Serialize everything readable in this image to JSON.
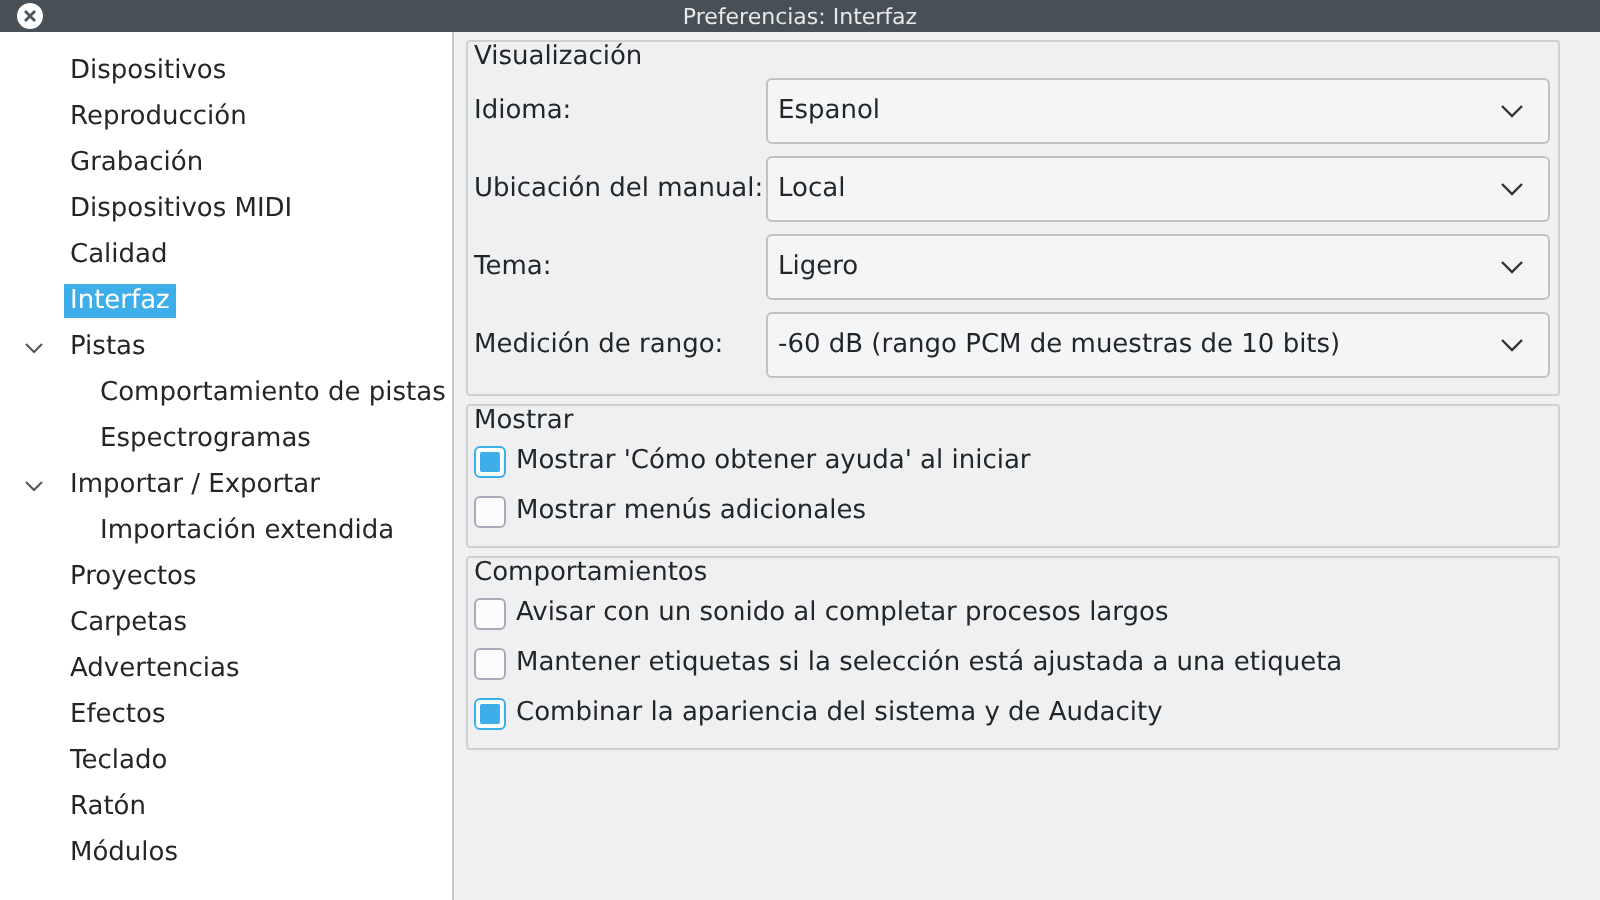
{
  "window": {
    "title": "Preferencias: Interfaz"
  },
  "sidebar": {
    "items": [
      {
        "label": "Dispositivos",
        "selected": false
      },
      {
        "label": "Reproducción",
        "selected": false
      },
      {
        "label": "Grabación",
        "selected": false
      },
      {
        "label": "Dispositivos MIDI",
        "selected": false
      },
      {
        "label": "Calidad",
        "selected": false
      },
      {
        "label": "Interfaz",
        "selected": true
      },
      {
        "label": "Pistas",
        "selected": false,
        "expanded": true,
        "children": [
          {
            "label": "Comportamiento de pistas",
            "selected": false
          },
          {
            "label": "Espectrogramas",
            "selected": false
          }
        ]
      },
      {
        "label": "Importar / Exportar",
        "selected": false,
        "expanded": true,
        "children": [
          {
            "label": "Importación extendida",
            "selected": false
          }
        ]
      },
      {
        "label": "Proyectos",
        "selected": false
      },
      {
        "label": "Carpetas",
        "selected": false
      },
      {
        "label": "Advertencias",
        "selected": false
      },
      {
        "label": "Efectos",
        "selected": false
      },
      {
        "label": "Teclado",
        "selected": false
      },
      {
        "label": "Ratón",
        "selected": false
      },
      {
        "label": "Módulos",
        "selected": false
      }
    ]
  },
  "groups": [
    {
      "title": "Visualización",
      "kind": "combos",
      "fields": [
        {
          "label": "Idioma:",
          "value": "Espanol"
        },
        {
          "label": "Ubicación del manual:",
          "value": "Local"
        },
        {
          "label": "Tema:",
          "value": "Ligero"
        },
        {
          "label": "Medición de rango:",
          "value": "-60 dB (rango PCM de muestras de 10 bits)"
        }
      ]
    },
    {
      "title": "Mostrar",
      "kind": "checks",
      "options": [
        {
          "label": "Mostrar 'Cómo obtener ayuda' al iniciar",
          "checked": true
        },
        {
          "label": "Mostrar menús adicionales",
          "checked": false
        }
      ]
    },
    {
      "title": "Comportamientos",
      "kind": "checks",
      "options": [
        {
          "label": "Avisar con un sonido al completar procesos largos",
          "checked": false
        },
        {
          "label": "Mantener etiquetas si la selección está ajustada a una etiqueta",
          "checked": false
        },
        {
          "label": "Combinar la apariencia del sistema y de Audacity",
          "checked": true
        }
      ]
    }
  ]
}
